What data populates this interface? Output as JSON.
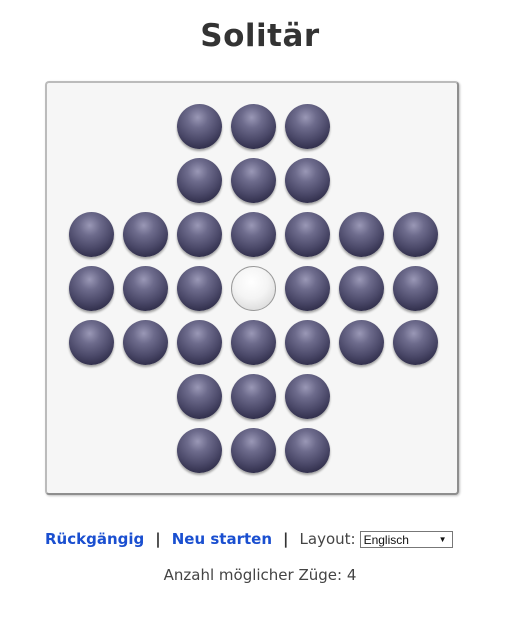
{
  "title": "Solitär",
  "board": {
    "rows": [
      "  OOO  ",
      "  OOO  ",
      "OOOOOOO",
      "OOO.OOO",
      "OOOOOOO",
      "  OOO  ",
      "  OOO  "
    ],
    "legend": {
      "O": "peg",
      ".": "empty hole"
    },
    "peg_color": "#4a4868",
    "empty_color": "#f4f4f4"
  },
  "controls": {
    "undo_label": "Rückgängig",
    "separator": "|",
    "restart_label": "Neu starten",
    "layout_label": "Layout:",
    "layout_selected": "Englisch",
    "link_color": "#1a4fd0"
  },
  "status": {
    "possible_moves": "Anzahl möglicher Züge: 4"
  }
}
